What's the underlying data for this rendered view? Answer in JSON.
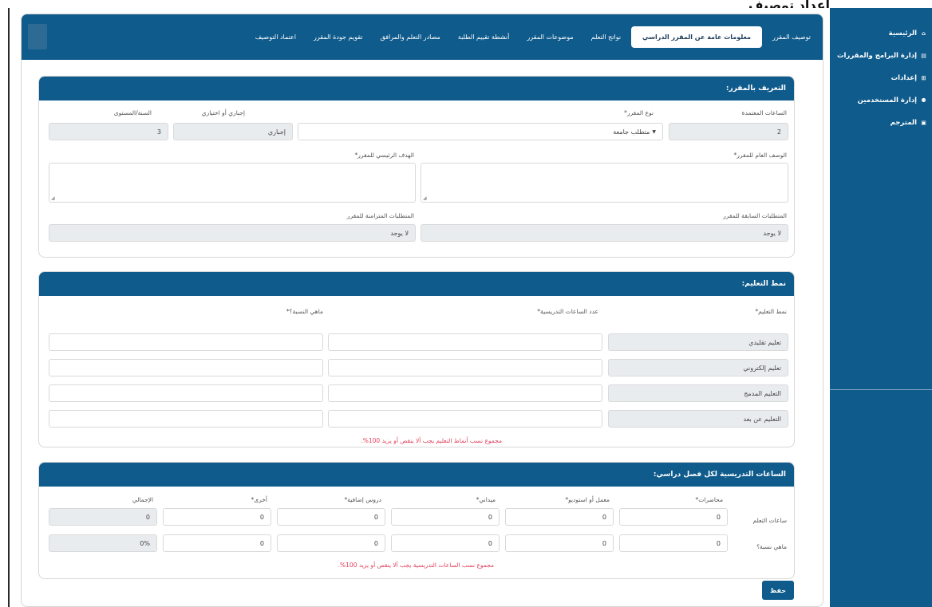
{
  "header": {
    "title": "إعداد توصيف المقرر"
  },
  "sidebar": {
    "items": [
      {
        "label": "الرئيسية",
        "icon": "house-icon",
        "glyph": "⌂"
      },
      {
        "label": "إدارة البرامج والمقررات",
        "icon": "book-icon",
        "glyph": "▤"
      },
      {
        "label": "إعدادات",
        "icon": "settings-icon",
        "glyph": "⊞"
      },
      {
        "label": "إدارة المستخدمين",
        "icon": "users-icon",
        "glyph": "⚉"
      },
      {
        "label": "المترجم",
        "icon": "translate-icon",
        "glyph": "▣"
      }
    ]
  },
  "tabs": [
    "توصيف المقرر",
    "معلومات عامة عن المقرر الدراسي",
    "نواتج التعلم",
    "موضوعات المقرر",
    "أنشطة تقييم الطلبة",
    "مصادر التعلم والمرافق",
    "تقويم جودة المقرر",
    "اعتماد التوصيف"
  ],
  "course_info": {
    "title": "التعريف بالمقرر:",
    "credit_hours_label": "الساعات المعتمدة",
    "credit_hours_value": "2",
    "course_type_label": "نوع المقرر*",
    "course_type_value": "متطلب جامعة",
    "mandatory_label": "إجباري أو اختياري",
    "mandatory_value": "إجباري",
    "year_level_label": "السنة/المستوى",
    "year_level_value": "3",
    "general_desc_label": "الوصف العام للمقرر*",
    "main_goal_label": "الهدف الرئيسي للمقرر*",
    "prereq_label": "المتطلبات السابقة للمقرر",
    "prereq_value": "لا يوجد",
    "coreq_label": "المتطلبات المتزامنة للمقرر",
    "coreq_value": "لا يوجد"
  },
  "learning_mode": {
    "title": "نمط التعليم:",
    "col_mode": "نمط التعليم*",
    "col_hours": "عدد الساعات التدريسية*",
    "col_percent": "ماهي النسبة؟*",
    "rows": [
      "تعليم تقليدي",
      "تعليم إلكتروني",
      "التعليم المدمج",
      "التعليم عن بعد"
    ],
    "note": "مجموع نسب أنماط التعليم يجب ألا ينقص أو يزيد 100%."
  },
  "hours": {
    "title": "الساعات التدريسية لكل فصل دراسي:",
    "columns": [
      "محاضرات*",
      "معمل أو استوديو*",
      "ميداني*",
      "دروس إضافية*",
      "أخرى*",
      "الإجمالي"
    ],
    "row1_label": "ساعات التعلم",
    "row1_values": [
      "0",
      "0",
      "0",
      "0",
      "0",
      "0"
    ],
    "row2_label": "ماهي نسبة؟",
    "row2_values": [
      "0",
      "0",
      "0",
      "0",
      "0",
      "0%"
    ],
    "note": "مجموع نسب الساعات التدريسية يجب ألا ينقص أو يزيد 100%."
  },
  "actions": {
    "save_label": "حفظ"
  }
}
